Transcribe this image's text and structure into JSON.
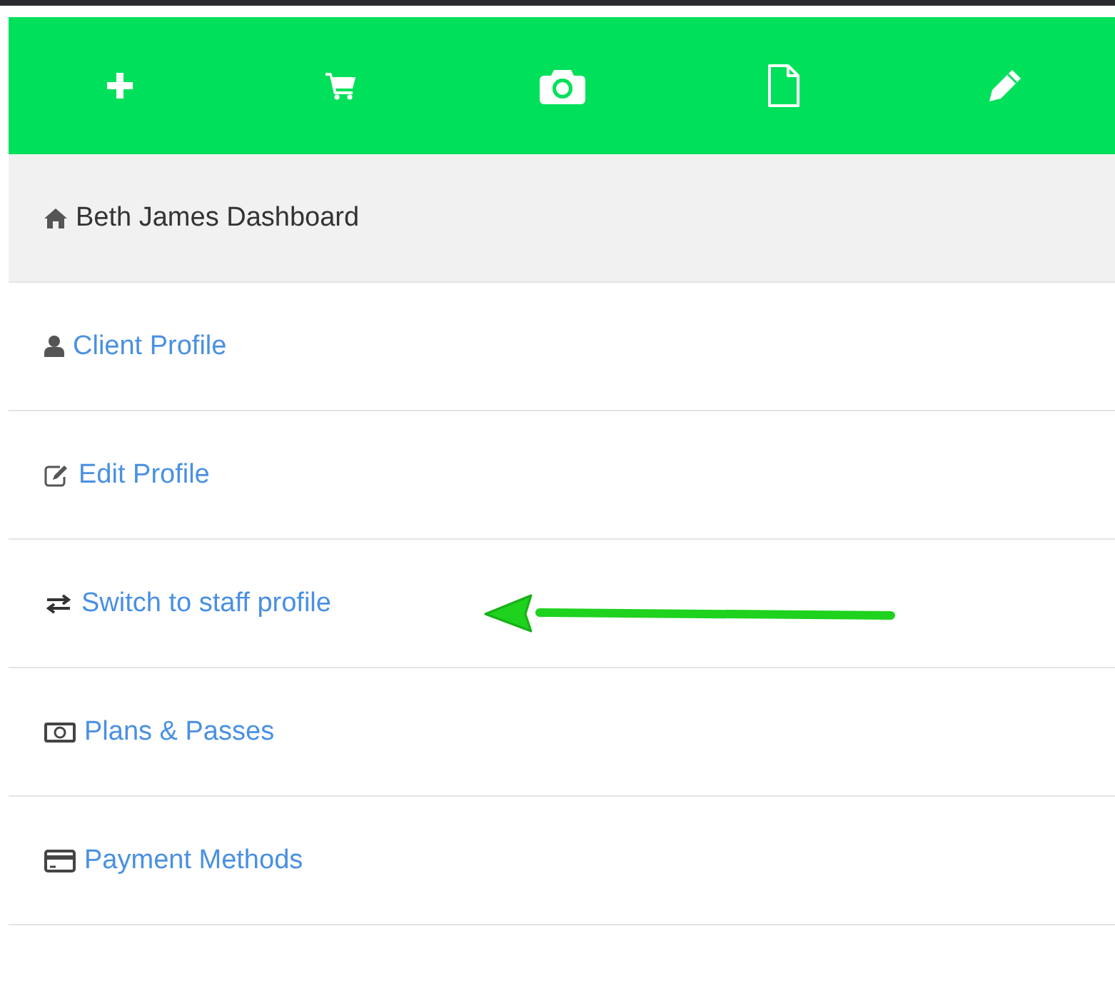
{
  "toolbar": [
    {
      "kind": "plus"
    },
    {
      "kind": "cart"
    },
    {
      "kind": "camera"
    },
    {
      "kind": "file"
    },
    {
      "kind": "pencil"
    }
  ],
  "dashboard": {
    "label": "Beth James Dashboard"
  },
  "menu": [
    {
      "kind": "user",
      "label": "Client Profile"
    },
    {
      "kind": "edit",
      "label": "Edit Profile"
    },
    {
      "kind": "switch",
      "label": "Switch to staff profile"
    },
    {
      "kind": "money",
      "label": "Plans & Passes"
    },
    {
      "kind": "card",
      "label": "Payment Methods"
    }
  ]
}
